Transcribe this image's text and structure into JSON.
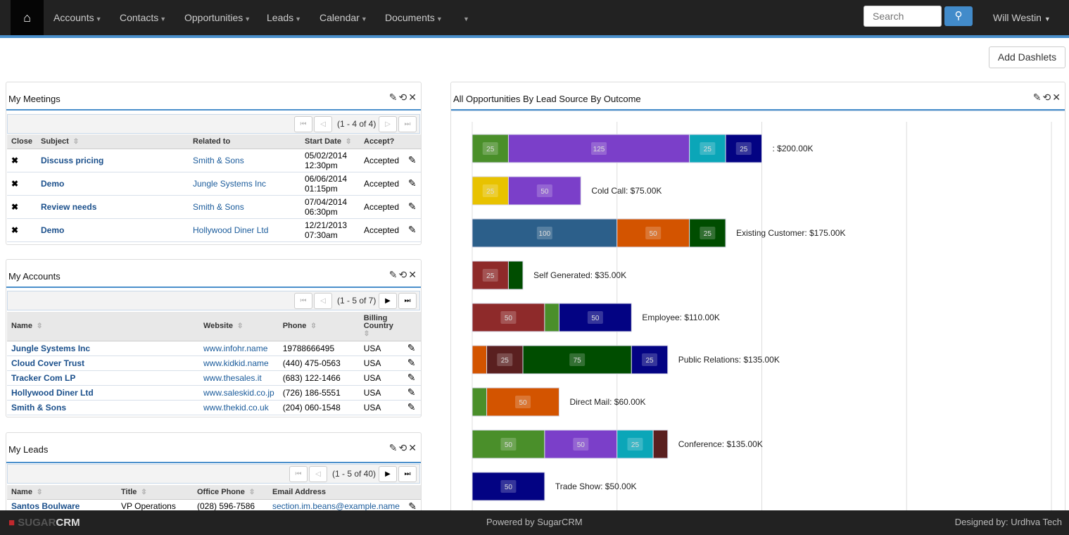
{
  "nav": {
    "home_icon": "home-icon",
    "items": [
      "Accounts",
      "Contacts",
      "Opportunities",
      "Leads",
      "Calendar",
      "Documents",
      ""
    ],
    "search_placeholder": "Search",
    "search_icon": "search-icon",
    "user": "Will Westin"
  },
  "add_dashlets": "Add Dashlets",
  "meetings": {
    "title": "My Meetings",
    "pager": "(1 - 4 of 4)",
    "columns": [
      "Close",
      "Subject",
      "Related to",
      "Start Date",
      "Accept?"
    ],
    "rows": [
      [
        "Discuss pricing",
        "Smith & Sons",
        "05/02/2014",
        "12:30pm",
        "Accepted"
      ],
      [
        "Demo",
        "Jungle Systems Inc",
        "06/06/2014",
        "01:15pm",
        "Accepted"
      ],
      [
        "Review needs",
        "Smith & Sons",
        "07/04/2014",
        "06:30pm",
        "Accepted"
      ],
      [
        "Demo",
        "Hollywood Diner Ltd",
        "12/21/2013",
        "07:30am",
        "Accepted"
      ]
    ]
  },
  "accounts": {
    "title": "My Accounts",
    "pager": "(1 - 5 of 7)",
    "columns": [
      "Name",
      "Website",
      "Phone",
      "Billing Country"
    ],
    "rows": [
      [
        "Jungle Systems Inc",
        "www.infohr.name",
        "19788666495",
        "USA"
      ],
      [
        "Cloud Cover Trust",
        "www.kidkid.name",
        "(440) 475-0563",
        "USA"
      ],
      [
        "Tracker Com LP",
        "www.thesales.it",
        "(683) 122-1466",
        "USA"
      ],
      [
        "Hollywood Diner Ltd",
        "www.saleskid.co.jp",
        "(726) 186-5551",
        "USA"
      ],
      [
        "Smith & Sons",
        "www.thekid.co.uk",
        "(204) 060-1548",
        "USA"
      ]
    ]
  },
  "leads": {
    "title": "My Leads",
    "pager": "(1 - 5 of 40)",
    "columns": [
      "Name",
      "Title",
      "Office Phone",
      "Email Address"
    ],
    "rows": [
      [
        "Santos Boulware",
        "VP Operations",
        "(028) 596-7586",
        "section.im.beans@example.name"
      ]
    ]
  },
  "opps": {
    "title": "All Opportunities By Lead Source By Outcome"
  },
  "chart_data": {
    "type": "bar",
    "orientation": "horizontal",
    "stacked": true,
    "unit": "$K",
    "xlim": [
      0,
      400
    ],
    "grid": true,
    "categories": [
      "",
      "Cold Call",
      "Existing Customer",
      "Self Generated",
      "Employee",
      "Public Relations",
      "Direct Mail",
      "Conference",
      "Trade Show"
    ],
    "totals": [
      ": $200.00K",
      "Cold Call: $75.00K",
      "Existing Customer: $175.00K",
      "Self Generated: $35.00K",
      "Employee: $110.00K",
      "Public Relations: $135.00K",
      "Direct Mail: $60.00K",
      "Conference: $135.00K",
      "Trade Show: $50.00K"
    ],
    "segments": [
      [
        [
          25,
          "#4a8f2a"
        ],
        [
          125,
          "#7b3fc9"
        ],
        [
          25,
          "#0ba6b8"
        ],
        [
          25,
          "#030383"
        ]
      ],
      [
        [
          25,
          "#e8c200"
        ],
        [
          50,
          "#7b3fc9"
        ]
      ],
      [
        [
          100,
          "#2c5f8a"
        ],
        [
          50,
          "#d35400"
        ],
        [
          25,
          "#004d00"
        ]
      ],
      [
        [
          25,
          "#8e2a2a"
        ],
        [
          10,
          "#004d00"
        ]
      ],
      [
        [
          50,
          "#8e2a2a"
        ],
        [
          10,
          "#4a8f2a"
        ],
        [
          50,
          "#030383"
        ]
      ],
      [
        [
          10,
          "#d35400"
        ],
        [
          25,
          "#5a2020"
        ],
        [
          75,
          "#004d00"
        ],
        [
          25,
          "#030383"
        ]
      ],
      [
        [
          10,
          "#4a8f2a"
        ],
        [
          50,
          "#d35400"
        ]
      ],
      [
        [
          50,
          "#4a8f2a"
        ],
        [
          50,
          "#7b3fc9"
        ],
        [
          25,
          "#0ba6b8"
        ],
        [
          10,
          "#5a2020"
        ]
      ],
      [
        [
          50,
          "#030383"
        ]
      ]
    ]
  },
  "footer": {
    "logo": "SUGARCRM",
    "powered": "Powered by SugarCRM",
    "designed": "Designed by: Urdhva Tech"
  }
}
